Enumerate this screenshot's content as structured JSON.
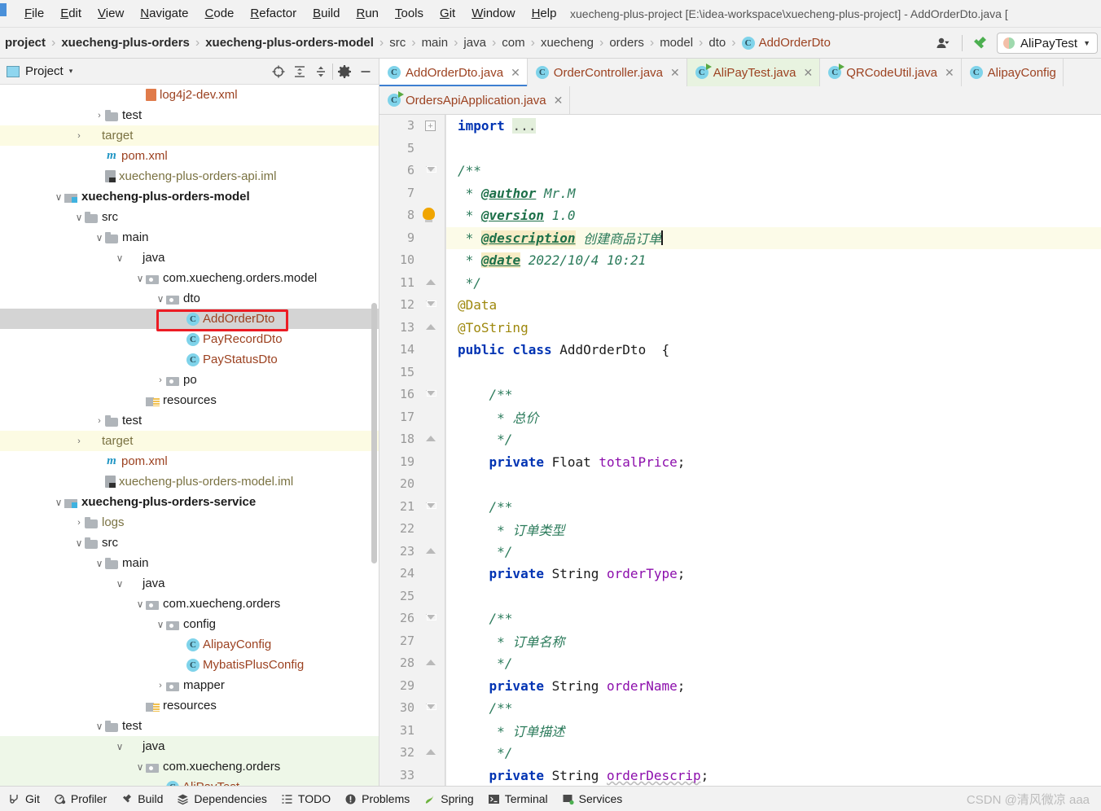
{
  "window": {
    "title": "xuecheng-plus-project [E:\\idea-workspace\\xuecheng-plus-project] - AddOrderDto.java ["
  },
  "menubar": {
    "items": [
      {
        "pre": "F",
        "rest": "ile"
      },
      {
        "pre": "E",
        "rest": "dit"
      },
      {
        "pre": "V",
        "rest": "iew"
      },
      {
        "pre": "N",
        "rest": "avigate"
      },
      {
        "pre": "C",
        "rest": "ode"
      },
      {
        "pre": "R",
        "rest": "efactor"
      },
      {
        "pre": "B",
        "rest": "uild"
      },
      {
        "pre": "R",
        "rest": "un"
      },
      {
        "pre": "T",
        "rest": "ools"
      },
      {
        "pre": "G",
        "rest": "it"
      },
      {
        "pre": "W",
        "rest": "indow"
      },
      {
        "pre": "H",
        "rest": "elp"
      }
    ]
  },
  "breadcrumb": {
    "items": [
      {
        "label": "project",
        "style": "bold"
      },
      {
        "label": "xuecheng-plus-orders",
        "style": "bold"
      },
      {
        "label": "xuecheng-plus-orders-model",
        "style": "bold"
      },
      {
        "label": "src",
        "style": "plain"
      },
      {
        "label": "main",
        "style": "plain"
      },
      {
        "label": "java",
        "style": "plain"
      },
      {
        "label": "com",
        "style": "plain"
      },
      {
        "label": "xuecheng",
        "style": "plain"
      },
      {
        "label": "orders",
        "style": "plain"
      },
      {
        "label": "model",
        "style": "plain"
      },
      {
        "label": "dto",
        "style": "plain"
      }
    ],
    "class_badge": "C",
    "class_name": "AddOrderDto",
    "separator": "›"
  },
  "toolbar": {
    "user_icon": "user-icon",
    "build_icon": "hammer-icon",
    "run_config_label": "AliPayTest",
    "run_config_caret": "▼"
  },
  "project_panel": {
    "title": "Project",
    "title_caret": "▾",
    "tools": [
      {
        "name": "locate-icon"
      },
      {
        "name": "expand-all-icon"
      },
      {
        "name": "collapse-all-icon"
      },
      {
        "name": "settings-gear-icon"
      },
      {
        "name": "hide-panel-icon"
      }
    ],
    "tree": [
      {
        "indent": 5,
        "twist": "",
        "icon": "xml",
        "label": "log4j2-dev.xml",
        "color": "orange",
        "row": "normal"
      },
      {
        "indent": 3,
        "twist": "›",
        "icon": "folder",
        "label": "test",
        "color": "plain",
        "row": "normal"
      },
      {
        "indent": 2,
        "twist": "›",
        "icon": "folder-orange",
        "label": "target",
        "color": "olive",
        "row": "yellow"
      },
      {
        "indent": 3,
        "twist": "",
        "icon": "mvn",
        "label": "pom.xml",
        "color": "orange",
        "row": "normal"
      },
      {
        "indent": 3,
        "twist": "",
        "icon": "iml",
        "label": "xuecheng-plus-orders-api.iml",
        "color": "olive",
        "row": "normal"
      },
      {
        "indent": 1,
        "twist": "⌄",
        "icon": "module",
        "label": "xuecheng-plus-orders-model",
        "color": "bold",
        "row": "normal"
      },
      {
        "indent": 2,
        "twist": "⌄",
        "icon": "folder",
        "label": "src",
        "color": "plain",
        "row": "normal"
      },
      {
        "indent": 3,
        "twist": "⌄",
        "icon": "folder",
        "label": "main",
        "color": "plain",
        "row": "normal"
      },
      {
        "indent": 4,
        "twist": "⌄",
        "icon": "folder-blue",
        "label": "java",
        "color": "plain",
        "row": "normal"
      },
      {
        "indent": 5,
        "twist": "⌄",
        "icon": "pkg",
        "label": "com.xuecheng.orders.model",
        "color": "plain",
        "row": "normal"
      },
      {
        "indent": 6,
        "twist": "⌄",
        "icon": "pkg",
        "label": "dto",
        "color": "plain",
        "row": "normal"
      },
      {
        "indent": 7,
        "twist": "",
        "icon": "cls",
        "label": "AddOrderDto",
        "color": "orange",
        "row": "selected"
      },
      {
        "indent": 7,
        "twist": "",
        "icon": "cls",
        "label": "PayRecordDto",
        "color": "orange",
        "row": "normal"
      },
      {
        "indent": 7,
        "twist": "",
        "icon": "cls",
        "label": "PayStatusDto",
        "color": "orange",
        "row": "normal"
      },
      {
        "indent": 6,
        "twist": "›",
        "icon": "pkg",
        "label": "po",
        "color": "plain",
        "row": "normal"
      },
      {
        "indent": 5,
        "twist": "",
        "icon": "res",
        "label": "resources",
        "color": "plain",
        "row": "normal"
      },
      {
        "indent": 3,
        "twist": "›",
        "icon": "folder",
        "label": "test",
        "color": "plain",
        "row": "normal"
      },
      {
        "indent": 2,
        "twist": "›",
        "icon": "folder-orange",
        "label": "target",
        "color": "olive",
        "row": "yellow"
      },
      {
        "indent": 3,
        "twist": "",
        "icon": "mvn",
        "label": "pom.xml",
        "color": "orange",
        "row": "normal"
      },
      {
        "indent": 3,
        "twist": "",
        "icon": "iml",
        "label": "xuecheng-plus-orders-model.iml",
        "color": "olive",
        "row": "normal"
      },
      {
        "indent": 1,
        "twist": "⌄",
        "icon": "module",
        "label": "xuecheng-plus-orders-service",
        "color": "bold",
        "row": "normal"
      },
      {
        "indent": 2,
        "twist": "›",
        "icon": "folder",
        "label": "logs",
        "color": "olive",
        "row": "normal"
      },
      {
        "indent": 2,
        "twist": "⌄",
        "icon": "folder",
        "label": "src",
        "color": "plain",
        "row": "normal"
      },
      {
        "indent": 3,
        "twist": "⌄",
        "icon": "folder",
        "label": "main",
        "color": "plain",
        "row": "normal"
      },
      {
        "indent": 4,
        "twist": "⌄",
        "icon": "folder-blue",
        "label": "java",
        "color": "plain",
        "row": "normal"
      },
      {
        "indent": 5,
        "twist": "⌄",
        "icon": "pkg",
        "label": "com.xuecheng.orders",
        "color": "plain",
        "row": "normal"
      },
      {
        "indent": 6,
        "twist": "⌄",
        "icon": "pkg",
        "label": "config",
        "color": "plain",
        "row": "normal"
      },
      {
        "indent": 7,
        "twist": "",
        "icon": "cls",
        "label": "AlipayConfig",
        "color": "orange",
        "row": "normal"
      },
      {
        "indent": 7,
        "twist": "",
        "icon": "cls",
        "label": "MybatisPlusConfig",
        "color": "orange",
        "row": "normal"
      },
      {
        "indent": 6,
        "twist": "›",
        "icon": "pkg",
        "label": "mapper",
        "color": "plain",
        "row": "normal"
      },
      {
        "indent": 5,
        "twist": "",
        "icon": "res",
        "label": "resources",
        "color": "plain",
        "row": "normal"
      },
      {
        "indent": 3,
        "twist": "⌄",
        "icon": "folder",
        "label": "test",
        "color": "plain",
        "row": "normal"
      },
      {
        "indent": 4,
        "twist": "⌄",
        "icon": "folder-green",
        "label": "java",
        "color": "plain",
        "row": "green"
      },
      {
        "indent": 5,
        "twist": "⌄",
        "icon": "pkg",
        "label": "com.xuecheng.orders",
        "color": "plain",
        "row": "green"
      },
      {
        "indent": 6,
        "twist": "",
        "icon": "cls",
        "label": "AliPayTest",
        "color": "orange",
        "row": "green"
      }
    ]
  },
  "editor": {
    "tabs_row1": [
      {
        "label": "AddOrderDto.java",
        "icon": "class-icon",
        "state": "active",
        "close": "✕"
      },
      {
        "label": "OrderController.java",
        "icon": "class-icon",
        "state": "normal",
        "close": "✕"
      },
      {
        "label": "AliPayTest.java",
        "icon": "class-run-icon",
        "state": "green",
        "close": "✕"
      },
      {
        "label": "QRCodeUtil.java",
        "icon": "class-run-icon",
        "state": "normal",
        "close": "✕"
      },
      {
        "label": "AlipayConfig",
        "icon": "class-icon",
        "state": "normal",
        "close": ""
      }
    ],
    "tabs_row2": [
      {
        "label": "OrdersApiApplication.java",
        "icon": "spring-icon",
        "state": "normal",
        "close": "✕"
      }
    ],
    "line_numbers": [
      "3",
      "5",
      "6",
      "7",
      "8",
      "9",
      "10",
      "11",
      "12",
      "13",
      "14",
      "15",
      "16",
      "17",
      "18",
      "19",
      "20",
      "21",
      "22",
      "23",
      "24",
      "25",
      "26",
      "27",
      "28",
      "29",
      "30",
      "31",
      "32",
      "33"
    ],
    "code": [
      {
        "n": "3",
        "fold": "plus",
        "hl": false,
        "tokens": [
          {
            "t": "import ",
            "c": "k"
          },
          {
            "t": "...",
            "c": "elip"
          }
        ]
      },
      {
        "n": "5",
        "fold": "none",
        "hl": false,
        "tokens": []
      },
      {
        "n": "6",
        "fold": "open",
        "hl": false,
        "tokens": [
          {
            "t": "/**",
            "c": "cm"
          }
        ]
      },
      {
        "n": "7",
        "fold": "none",
        "hl": false,
        "tokens": [
          {
            "t": " * ",
            "c": "cm"
          },
          {
            "t": "@author",
            "c": "tg"
          },
          {
            "t": " Mr.M",
            "c": "cm"
          }
        ]
      },
      {
        "n": "8",
        "fold": "bulb",
        "hl": false,
        "tokens": [
          {
            "t": " * ",
            "c": "cm"
          },
          {
            "t": "@version",
            "c": "tg"
          },
          {
            "t": " 1.0",
            "c": "cm"
          }
        ]
      },
      {
        "n": "9",
        "fold": "none",
        "hl": true,
        "tokens": [
          {
            "t": " * ",
            "c": "cm"
          },
          {
            "t": "@description",
            "c": "tgh"
          },
          {
            "t": " 创建商品订单",
            "c": "cm"
          },
          {
            "t": "|",
            "c": "caret"
          }
        ]
      },
      {
        "n": "10",
        "fold": "none",
        "hl": false,
        "tokens": [
          {
            "t": " * ",
            "c": "cm"
          },
          {
            "t": "@date",
            "c": "tgh"
          },
          {
            "t": " 2022/10/4 10:21",
            "c": "cm"
          }
        ]
      },
      {
        "n": "11",
        "fold": "close",
        "hl": false,
        "tokens": [
          {
            "t": " */",
            "c": "cm"
          }
        ]
      },
      {
        "n": "12",
        "fold": "open",
        "hl": false,
        "tokens": [
          {
            "t": "@Data",
            "c": "an"
          }
        ]
      },
      {
        "n": "13",
        "fold": "close",
        "hl": false,
        "tokens": [
          {
            "t": "@ToString",
            "c": "an"
          }
        ]
      },
      {
        "n": "14",
        "fold": "none",
        "hl": false,
        "tokens": [
          {
            "t": "public class ",
            "c": "k"
          },
          {
            "t": "AddOrderDto",
            "c": "cn"
          },
          {
            "t": "  {",
            "c": "cn"
          }
        ]
      },
      {
        "n": "15",
        "fold": "none",
        "hl": false,
        "tokens": []
      },
      {
        "n": "16",
        "fold": "open",
        "hl": false,
        "tokens": [
          {
            "t": "    /**",
            "c": "cm"
          }
        ]
      },
      {
        "n": "17",
        "fold": "none",
        "hl": false,
        "tokens": [
          {
            "t": "     * 总价",
            "c": "cm"
          }
        ]
      },
      {
        "n": "18",
        "fold": "close",
        "hl": false,
        "tokens": [
          {
            "t": "     */",
            "c": "cm"
          }
        ]
      },
      {
        "n": "19",
        "fold": "none",
        "hl": false,
        "tokens": [
          {
            "t": "    private ",
            "c": "k"
          },
          {
            "t": "Float ",
            "c": "ty"
          },
          {
            "t": "totalPrice",
            "c": "fl"
          },
          {
            "t": ";",
            "c": "cn"
          }
        ]
      },
      {
        "n": "20",
        "fold": "none",
        "hl": false,
        "tokens": []
      },
      {
        "n": "21",
        "fold": "open",
        "hl": false,
        "tokens": [
          {
            "t": "    /**",
            "c": "cm"
          }
        ]
      },
      {
        "n": "22",
        "fold": "none",
        "hl": false,
        "tokens": [
          {
            "t": "     * 订单类型",
            "c": "cm"
          }
        ]
      },
      {
        "n": "23",
        "fold": "close",
        "hl": false,
        "tokens": [
          {
            "t": "     */",
            "c": "cm"
          }
        ]
      },
      {
        "n": "24",
        "fold": "none",
        "hl": false,
        "tokens": [
          {
            "t": "    private ",
            "c": "k"
          },
          {
            "t": "String ",
            "c": "ty"
          },
          {
            "t": "orderType",
            "c": "fl"
          },
          {
            "t": ";",
            "c": "cn"
          }
        ]
      },
      {
        "n": "25",
        "fold": "none",
        "hl": false,
        "tokens": []
      },
      {
        "n": "26",
        "fold": "open",
        "hl": false,
        "tokens": [
          {
            "t": "    /**",
            "c": "cm"
          }
        ]
      },
      {
        "n": "27",
        "fold": "none",
        "hl": false,
        "tokens": [
          {
            "t": "     * 订单名称",
            "c": "cm"
          }
        ]
      },
      {
        "n": "28",
        "fold": "close",
        "hl": false,
        "tokens": [
          {
            "t": "     */",
            "c": "cm"
          }
        ]
      },
      {
        "n": "29",
        "fold": "none",
        "hl": false,
        "tokens": [
          {
            "t": "    private ",
            "c": "k"
          },
          {
            "t": "String ",
            "c": "ty"
          },
          {
            "t": "orderName",
            "c": "fl"
          },
          {
            "t": ";",
            "c": "cn"
          }
        ]
      },
      {
        "n": "30",
        "fold": "open",
        "hl": false,
        "tokens": [
          {
            "t": "    /**",
            "c": "cm"
          }
        ]
      },
      {
        "n": "31",
        "fold": "none",
        "hl": false,
        "tokens": [
          {
            "t": "     * 订单描述",
            "c": "cm"
          }
        ]
      },
      {
        "n": "32",
        "fold": "close",
        "hl": false,
        "tokens": [
          {
            "t": "     */",
            "c": "cm"
          }
        ]
      },
      {
        "n": "33",
        "fold": "none",
        "hl": false,
        "tokens": [
          {
            "t": "    private ",
            "c": "k"
          },
          {
            "t": "String ",
            "c": "ty"
          },
          {
            "t": "orderDescrip",
            "c": "flw"
          },
          {
            "t": ";",
            "c": "cn"
          }
        ]
      }
    ]
  },
  "statusbar": {
    "items": [
      {
        "label": "Git",
        "icon": "git-branch-icon"
      },
      {
        "label": "Profiler",
        "icon": "profiler-icon"
      },
      {
        "label": "Build",
        "icon": "hammer-icon"
      },
      {
        "label": "Dependencies",
        "icon": "layers-icon"
      },
      {
        "label": "TODO",
        "icon": "list-icon"
      },
      {
        "label": "Problems",
        "icon": "exclamation-circle-icon"
      },
      {
        "label": "Spring",
        "icon": "spring-leaf-icon"
      },
      {
        "label": "Terminal",
        "icon": "terminal-icon"
      },
      {
        "label": "Services",
        "icon": "services-icon"
      }
    ],
    "watermark": "CSDN @清风微凉 aaa"
  },
  "colors": {
    "accent_blue": "#3d7fd1",
    "selected_row": "#d4d4d4",
    "annotation_red": "#ec1c24",
    "highlight_yellow": "#fcfbe3",
    "highlight_green": "#eef7e8"
  }
}
